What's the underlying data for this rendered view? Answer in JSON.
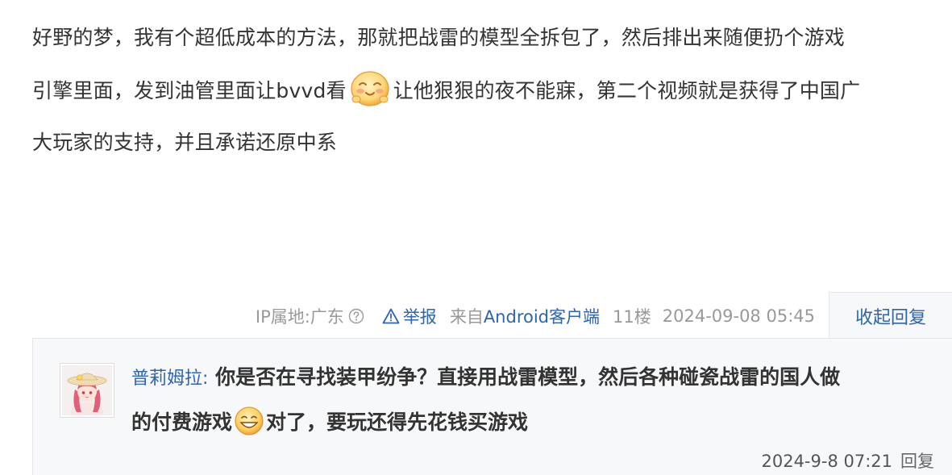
{
  "post": {
    "line1": "好野的梦，我有个超低成本的方法，那就把战雷的模型全拆包了，然后排出来随便扔个游戏",
    "line2_before": "引擎里面，发到油管里面让bvvd看",
    "line2_after": "让他狠狠的夜不能寐，第二个视频就是获得了中国广",
    "line3": "大玩家的支持，并且承诺还原中系",
    "emoji": "smile-blush-emoji"
  },
  "meta": {
    "ip": "IP属地:广东",
    "help_icon": "question-circle-icon",
    "report_icon": "warning-triangle-icon",
    "report_label": "举报",
    "source_prefix": "来自",
    "source_client": "Android客户端",
    "floor": "11楼",
    "time": "2024-09-08 05:45",
    "toggle_reply": "收起回复"
  },
  "reply": {
    "username": "普莉姆拉:",
    "line1": "你是否在寻找装甲纷争？直接用战雷模型，然后各种碰瓷战雷的国人做",
    "line2_before": "的付费游戏",
    "line2_after": "对了，要玩还得先花钱买游戏",
    "emoji": "grin-emoji",
    "time": "2024-9-8 07:21",
    "reply_label": "回复"
  },
  "colors": {
    "link": "#2d64b3",
    "meta": "#999999",
    "reply_bg": "#f7f8fa",
    "border": "#e4e6eb",
    "text": "#333333"
  }
}
